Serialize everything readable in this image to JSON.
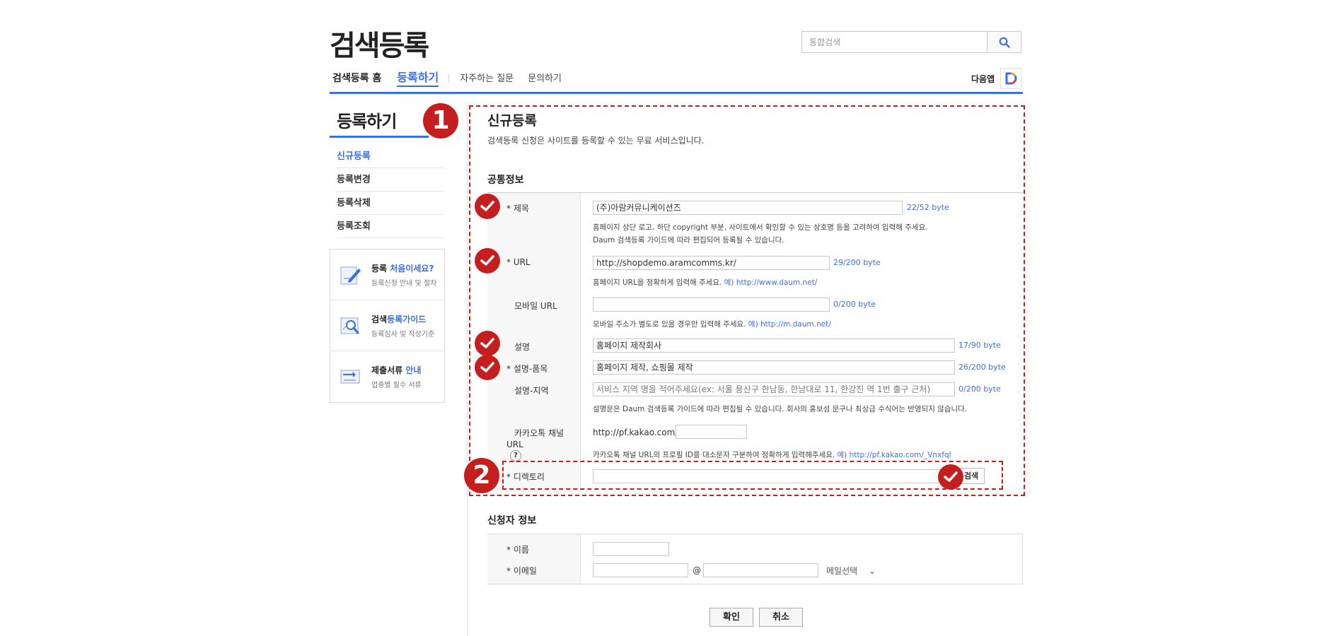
{
  "header": {
    "site_title": "검색등록",
    "search_placeholder": "통합검색",
    "search_icon": "search-icon",
    "daum_app_label": "다음앱"
  },
  "topnav": {
    "home": "검색등록 홈",
    "register": "등록하기",
    "separator": "|",
    "faq": "자주하는 질문",
    "inquiry": "문의하기"
  },
  "sidebar": {
    "title": "등록하기",
    "items": [
      {
        "label": "신규등록"
      },
      {
        "label": "등록변경"
      },
      {
        "label": "등록삭제"
      },
      {
        "label": "등록조회"
      }
    ],
    "promos": [
      {
        "title_plain": "등록 ",
        "title_accent": "처음이세요?",
        "sub": "등록신청 안내 및 절차",
        "icon": "pencil-icon"
      },
      {
        "title_plain": "검색",
        "title_accent": "등록가이드",
        "sub": "등록심사 및 작성기준",
        "icon": "magnifier-guide-icon"
      },
      {
        "title_plain": "제출서류 ",
        "title_accent": "안내",
        "sub": "업종별 필수 서류",
        "icon": "document-submit-icon"
      }
    ]
  },
  "main": {
    "title": "신규등록",
    "description": "검색등록 신청은 사이트를 등록할 수 있는 무료 서비스입니다.",
    "common_section": "공통정보",
    "applicant_section": "신청자 정보"
  },
  "form": {
    "title_label": "* 제목",
    "title_value": "(주)아람커뮤니케이션즈",
    "title_bytes": "22/52 byte",
    "title_help1": "홈페이지 상단 로고, 하단 copyright 부분, 사이트에서 확인할 수 있는 상호명 등을 고려하여 입력해 주세요.",
    "title_help2": "Daum 검색등록 가이드에 따라 편집되어 등록될 수 있습니다.",
    "url_label": "* URL",
    "url_value": "http://shopdemo.aramcomms.kr/",
    "url_bytes": "29/200 byte",
    "url_help": "홈페이지 URL을 정확하게 입력해 주세요.",
    "url_example": "예) http://www.daum.net/",
    "mobile_label": "모바일 URL",
    "mobile_value": "",
    "mobile_bytes": "0/200 byte",
    "mobile_help": "모바일 주소가 별도로 있을 경우만 입력해 주세요.",
    "mobile_example": "예) http://m.daum.net/",
    "desc_label": "설명",
    "desc_value": "홈페이지 제작회사",
    "desc_bytes": "17/90 byte",
    "desc_biz_label": "* 설명-품목",
    "desc_biz_value": "홈페이지 제작, 쇼핑몰 제작",
    "desc_biz_bytes": "26/200 byte",
    "desc_area_label": "설명-지역",
    "desc_area_placeholder": "서비스 지역 명을 적어주세요(ex: 서울  용산구 한남동, 한남대로 11, 한강진 역 1번 출구 근처)",
    "desc_area_bytes": "0/200 byte",
    "desc_help": "설명문은 Daum 검색등록 가이드에 따라 편집될 수 있습니다. 회사의 홍보성 문구나 최상급 수식어는 반영되지 않습니다.",
    "kakao_label1": "카카오톡 채널",
    "kakao_label2": "URL",
    "kakao_qmark": "?",
    "kakao_prefix": "http://pf.kakao.com/",
    "kakao_value": "",
    "kakao_help": "카카오톡 채널 URL의 프로필 ID를 대소문자 구분하여 정확하게 입력해주세요.",
    "kakao_example": "예) http://pf.kakao.com/_Vnxfql",
    "dir_label": "* 디렉토리",
    "dir_value": "",
    "dir_search_btn": "검색",
    "name_label": "* 이름",
    "name_value": "",
    "email_label": "* 이메일",
    "email_at": "@",
    "email_select": "메일선택",
    "confirm_btn": "확인",
    "cancel_btn": "취소"
  },
  "annotations": {
    "badge1": "1",
    "badge2": "2",
    "color": "#c41e1e"
  },
  "colors": {
    "accent": "#3b6fe0",
    "annotation": "#c41e1e"
  }
}
